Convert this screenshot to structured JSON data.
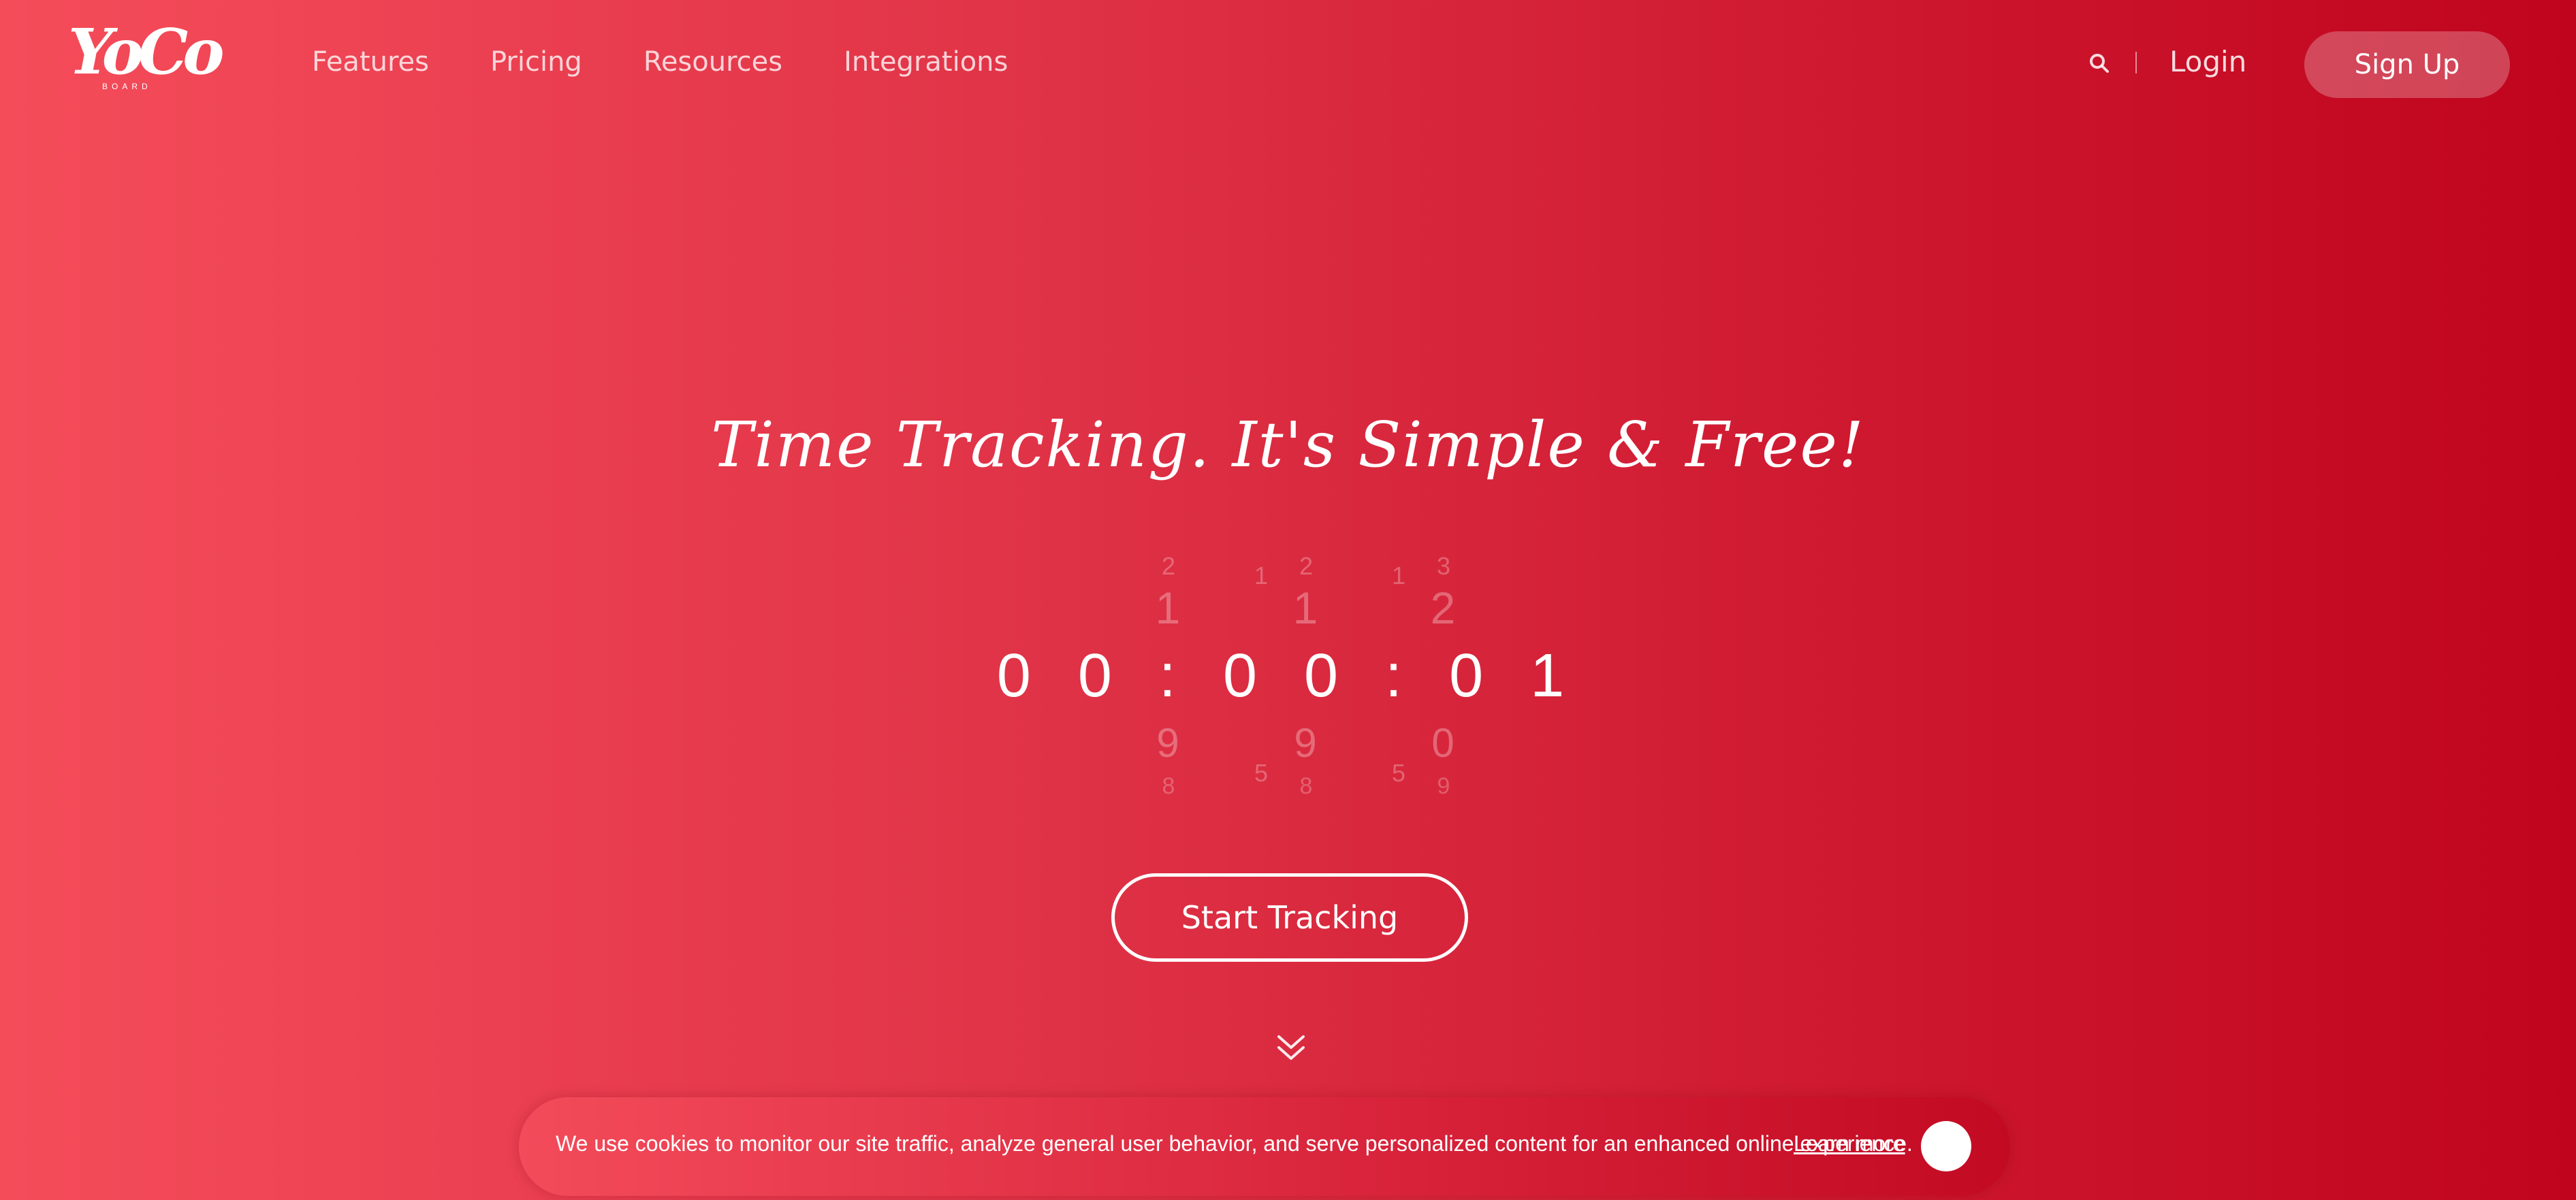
{
  "header": {
    "logo_text": "YoCo",
    "logo_sub": "BOARD",
    "nav": [
      "Features",
      "Pricing",
      "Resources",
      "Integrations"
    ],
    "login_label": "Login",
    "signup_label": "Sign Up",
    "search_icon": "search-icon"
  },
  "hero": {
    "headline": "Time Tracking. It's Simple & Free!",
    "time": "00:00:01",
    "time_display": "0 0 : 0 0 : 0 1",
    "digit_wheels": {
      "hours_up_small": "2",
      "hours_up": "1",
      "hours_down": "9",
      "hours_down_small": "8",
      "min_tens_up": "1",
      "min_tens_down": "5",
      "min_up_small": "2",
      "min_up": "1",
      "min_down": "9",
      "min_down_small": "8",
      "sec_tens_up": "1",
      "sec_tens_down": "5",
      "sec_up_small": "3",
      "sec_up": "2",
      "sec_down": "0",
      "sec_down_small": "9"
    },
    "cta_label": "Start Tracking",
    "scroll_icon": "double-chevron-down-icon"
  },
  "cookie": {
    "message": "We use cookies to monitor our site traffic, analyze general user behavior, and serve personalized content for an enhanced online experience.",
    "learn_more": "Learn more"
  },
  "colors": {
    "gradient_start": "#f54c5a",
    "gradient_end": "#c0041d",
    "text": "#ffffff"
  }
}
